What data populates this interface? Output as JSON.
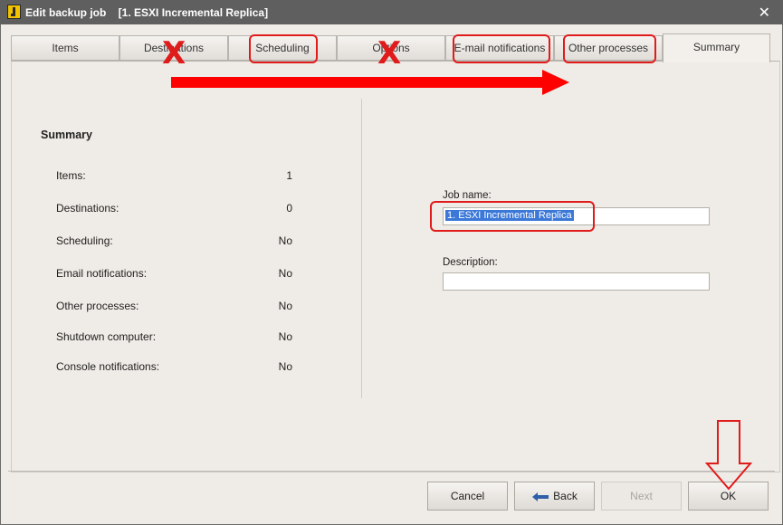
{
  "window": {
    "title": "Edit backup job    [1. ESXI Incremental Replica]",
    "close_glyph": "✕"
  },
  "tabs": [
    {
      "label": "Items"
    },
    {
      "label": "Destinations"
    },
    {
      "label": "Scheduling"
    },
    {
      "label": "Options"
    },
    {
      "label": "E-mail notifications"
    },
    {
      "label": "Other processes"
    },
    {
      "label": "Summary"
    }
  ],
  "summary": {
    "heading": "Summary",
    "rows": [
      {
        "label": "Items:",
        "value": "1"
      },
      {
        "label": "Destinations:",
        "value": "0"
      },
      {
        "label": "Scheduling:",
        "value": "No"
      },
      {
        "label": "Email notifications:",
        "value": "No"
      },
      {
        "label": "Other processes:",
        "value": "No"
      },
      {
        "label": "Shutdown computer:",
        "value": "No"
      },
      {
        "label": "Console notifications:",
        "value": "No"
      }
    ]
  },
  "job": {
    "name_label": "Job name:",
    "name_value": "1. ESXI Incremental Replica",
    "description_label": "Description:",
    "description_value": ""
  },
  "buttons": {
    "cancel": "Cancel",
    "back": "Back",
    "next": "Next",
    "ok": "OK"
  },
  "annotations": {
    "x_glyph": "X",
    "color": "#e01b1b"
  }
}
